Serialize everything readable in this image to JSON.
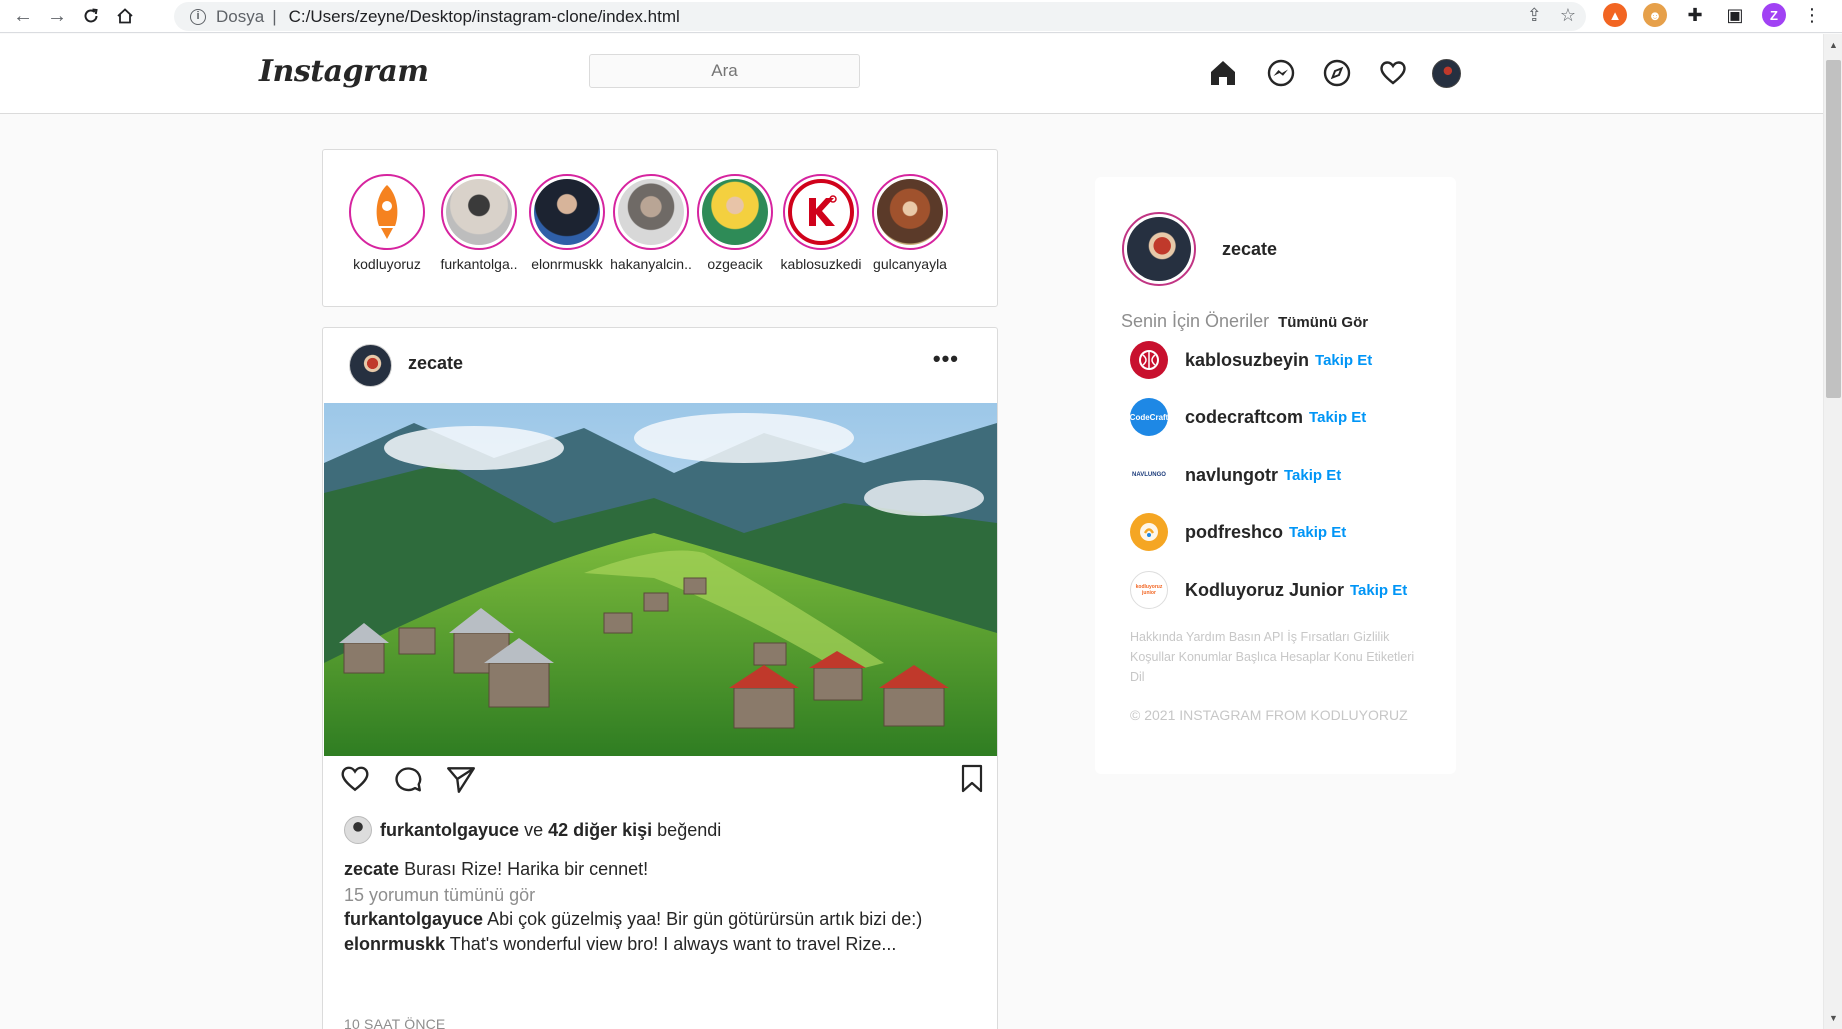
{
  "browser": {
    "scheme_label": "Dosya",
    "url": "C:/Users/zeyne/Desktop/instagram-clone/index.html",
    "profile_initial": "Z",
    "profile_color": "#a142f4"
  },
  "header": {
    "logo": "Instagram",
    "search_placeholder": "Ara",
    "nav_icons": [
      "home-icon",
      "messenger-icon",
      "explore-icon",
      "heart-icon",
      "profile-avatar"
    ]
  },
  "stories": [
    {
      "username": "kodluyoruz"
    },
    {
      "username": "furkantolga.."
    },
    {
      "username": "elonrmuskk"
    },
    {
      "username": "hakanyalcin.."
    },
    {
      "username": "ozgeacik"
    },
    {
      "username": "kablosuzkedi"
    },
    {
      "username": "gulcanyayla"
    }
  ],
  "post": {
    "username": "zecate",
    "more": "•••",
    "liked_by": "furkantolgayuce",
    "liked_conj": "ve",
    "liked_others": "42 diğer kişi",
    "liked_suffix": "beğendi",
    "caption_user": "zecate",
    "caption_text": "Burası Rize! Harika bir cennet!",
    "view_comments": "15 yorumun tümünü gör",
    "comments": [
      {
        "user": "furkantolgayuce",
        "text": "Abi çok güzelmiş yaa! Bir gün götürürsün artık bizi de:)"
      },
      {
        "user": "elonrmuskk",
        "text": "That's wonderful view bro! I always want to travel Rize..."
      }
    ],
    "time": "10 SAAT ÖNCE"
  },
  "sidebar": {
    "username": "zecate",
    "suggestions_title": "Senin İçin Öneriler",
    "see_all": "Tümünü Gör",
    "suggestions": [
      {
        "name": "kablosuzbeyin",
        "follow": "Takip Et",
        "color": "#c8102e"
      },
      {
        "name": "codecraftcom",
        "follow": "Takip Et",
        "color": "#1e88e5",
        "logo_text": "CodeCraft"
      },
      {
        "name": "navlungotr",
        "follow": "Takip Et",
        "color": "#ffffff",
        "logo_text": "NAVLUNGO"
      },
      {
        "name": "podfreshco",
        "follow": "Takip Et",
        "color": "#f5a623"
      },
      {
        "name": "Kodluyoruz Junior",
        "follow": "Takip Et",
        "color": "#ffffff",
        "logo_text": "kodluyoruz junior"
      }
    ],
    "footer_links": "Hakkında Yardım Basın API İş Fırsatları Gizlilik Koşullar Konumlar Başlıca Hesaplar Konu Etiketleri Dil",
    "copyright": "© 2021 INSTAGRAM FROM KODLUYORUZ"
  },
  "colors": {
    "story_ring": "#d6249f",
    "link_blue": "#0095f6",
    "muted": "#8e8e8e"
  }
}
